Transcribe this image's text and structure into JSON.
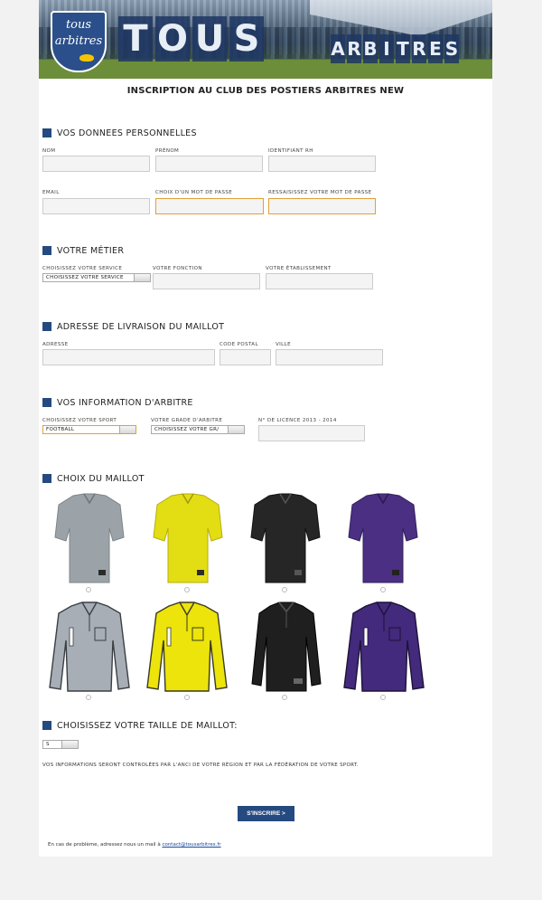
{
  "banner": {
    "logo_line1": "tous",
    "logo_line2": "arbitres",
    "word1": "TOUS",
    "word2": "ARBITRES"
  },
  "page_title": "INSCRIPTION AU CLUB DES POSTIERS ARBITRES NEW",
  "sections": {
    "personal": "VOS DONNEES PERSONNELLES",
    "job": "VOTRE MÉTIER",
    "address": "ADRESSE DE LIVRAISON DU MAILLOT",
    "referee": "VOS INFORMATION D'ARBITRE",
    "jersey": "CHOIX DU MAILLOT",
    "size": "CHOISISSEZ VOTRE TAILLE DE MAILLOT:"
  },
  "personal": {
    "nom": "NOM",
    "prenom": "PRÉNOM",
    "identifiant": "IDENTIFIANT RH",
    "email": "EMAIL",
    "password": "CHOIX D'UN MOT DE PASSE",
    "password_confirm": "RESSAISISSEZ VOTRE MOT DE PASSE"
  },
  "job": {
    "service_label": "CHOISISSEZ VOTRE SERVICE",
    "service_value": "CHOISISSEZ VOTRE SERVICE",
    "fonction_label": "VOTRE FONCTION",
    "etablissement_label": "VOTRE ÉTABLISSEMENT"
  },
  "address": {
    "adresse": "ADRESSE",
    "code_postal": "CODE POSTAL",
    "ville": "VILLE"
  },
  "referee": {
    "sport_label": "CHOISISSEZ VOTRE SPORT",
    "sport_value": "FOOTBALL",
    "grade_label": "VOTRE GRADE D'ARBITRE",
    "grade_value": "CHOISISSEZ VOTRE GR/",
    "licence_label": "N° DE LICENCE 2013 - 2014"
  },
  "jerseys": [
    {
      "name": "Grey short sleeve",
      "color": "#9ca3a8"
    },
    {
      "name": "Yellow short sleeve",
      "color": "#e3dd14"
    },
    {
      "name": "Black short sleeve",
      "color": "#262626"
    },
    {
      "name": "Purple short sleeve",
      "color": "#4a2f82"
    },
    {
      "name": "Grey long sleeve",
      "color": "#a7aeb5"
    },
    {
      "name": "Yellow long sleeve",
      "color": "#ece40a"
    },
    {
      "name": "Black long sleeve",
      "color": "#1f1f1f"
    },
    {
      "name": "Purple long sleeve",
      "color": "#432a7c"
    }
  ],
  "size": {
    "value": "S"
  },
  "note": "VOS INFORMATIONS SERONT CONTROLÉES PAR L'ANCI DE VOTRE RÉGION ET PAR LA FÉDÉRATION DE VOTRE SPORT.",
  "submit_label": "S'INSCRIRE >",
  "footer": {
    "text": "En cas de problème, adressez nous un mail à",
    "email": "contact@tousarbitres.fr"
  },
  "colors": {
    "accent": "#254a80",
    "highlight": "#e0a03a"
  }
}
